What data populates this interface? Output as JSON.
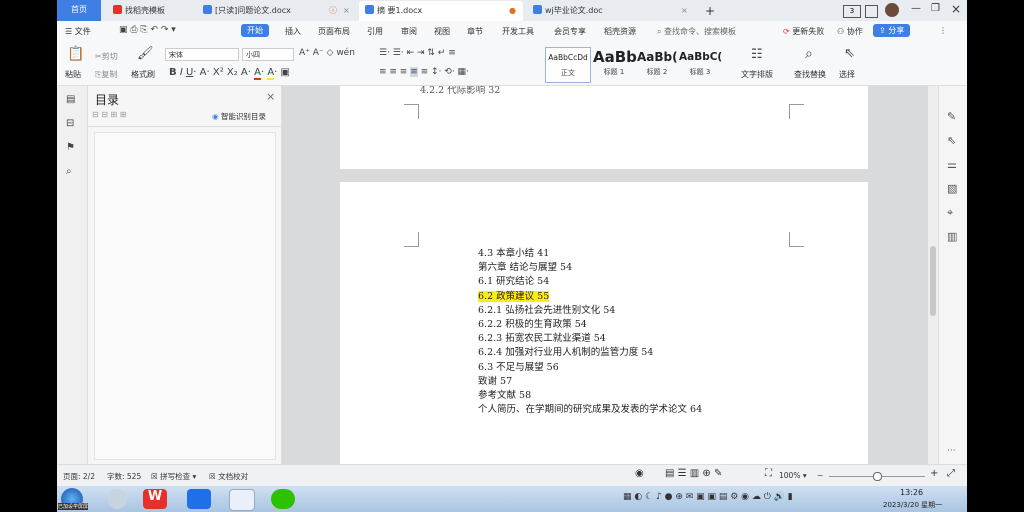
{
  "tabs": [
    {
      "label": "首页"
    },
    {
      "label": "找稻壳模板"
    },
    {
      "label": "[只读]问题论文.docx"
    },
    {
      "label": "摘 要1.docx"
    },
    {
      "label": "wj毕业论文.doc"
    }
  ],
  "new_tab": "+",
  "window_badge": "3",
  "menu": {
    "file": "文件",
    "items": [
      "开始",
      "插入",
      "页面布局",
      "引用",
      "审阅",
      "视图",
      "章节",
      "开发工具",
      "会员专享",
      "稻壳资源"
    ],
    "search_placeholder": "查找命令、搜索模板",
    "update": "更新失败",
    "collab": "协作",
    "share": "分享"
  },
  "toolbar": {
    "paste": "粘贴",
    "cut": "剪切",
    "copy": "复制",
    "format_painter": "格式刷",
    "font": "宋体",
    "font_size": "小四",
    "styles": [
      {
        "preview": "AaBbCcDd",
        "label": "正文"
      },
      {
        "preview": "AaBb",
        "label": "标题 1"
      },
      {
        "preview": "AaBb(",
        "label": "标题 2"
      },
      {
        "preview": "AaBbC(",
        "label": "标题 3"
      }
    ],
    "text_layout": "文字排版",
    "find_replace": "查找替换",
    "select": "选择"
  },
  "toc_panel": {
    "title": "目录",
    "smart": "智能识别目录"
  },
  "page1_partial": "4.2.2 代际影响    32",
  "toc_lines": [
    {
      "text": "4.3 本章小结    41",
      "highlight": false
    },
    {
      "text": "第六章  结论与展望 54",
      "highlight": false
    },
    {
      "text": "6.1 研究结论    54",
      "highlight": false
    },
    {
      "text": "6.2 政策建议    55",
      "highlight": true
    },
    {
      "text": "6.2.1 弘扬社会先进性别文化      54",
      "highlight": false
    },
    {
      "text": "6.2.2 积极的生育政策    54",
      "highlight": false
    },
    {
      "text": "6.2.3 拓宽农民工就业渠道    54",
      "highlight": false
    },
    {
      "text": "6.2.4 加强对行业用人机制的监管力度     54",
      "highlight": false
    },
    {
      "text": "6.3 不足与展望  56",
      "highlight": false
    },
    {
      "text": "致谢    57",
      "highlight": false
    },
    {
      "text": "参考文献    58",
      "highlight": false
    },
    {
      "text": "个人简历、在学期间的研究成果及发表的学术论文  64",
      "highlight": false
    }
  ],
  "status": {
    "page": "页面: 2/2",
    "words": "字数: 525",
    "spell": "拼写检查",
    "proof": "文档校对",
    "zoom": "100%",
    "zoom_minus": "−",
    "zoom_plus": "+"
  },
  "taskbar": {
    "time": "13:26",
    "date": "2023/3/20 星期一",
    "watermark": "已加设学屏屏"
  },
  "colors": {
    "accent": "#3f7fe3",
    "highlight": "#ffeb1a",
    "wps_red": "#e6302c"
  }
}
